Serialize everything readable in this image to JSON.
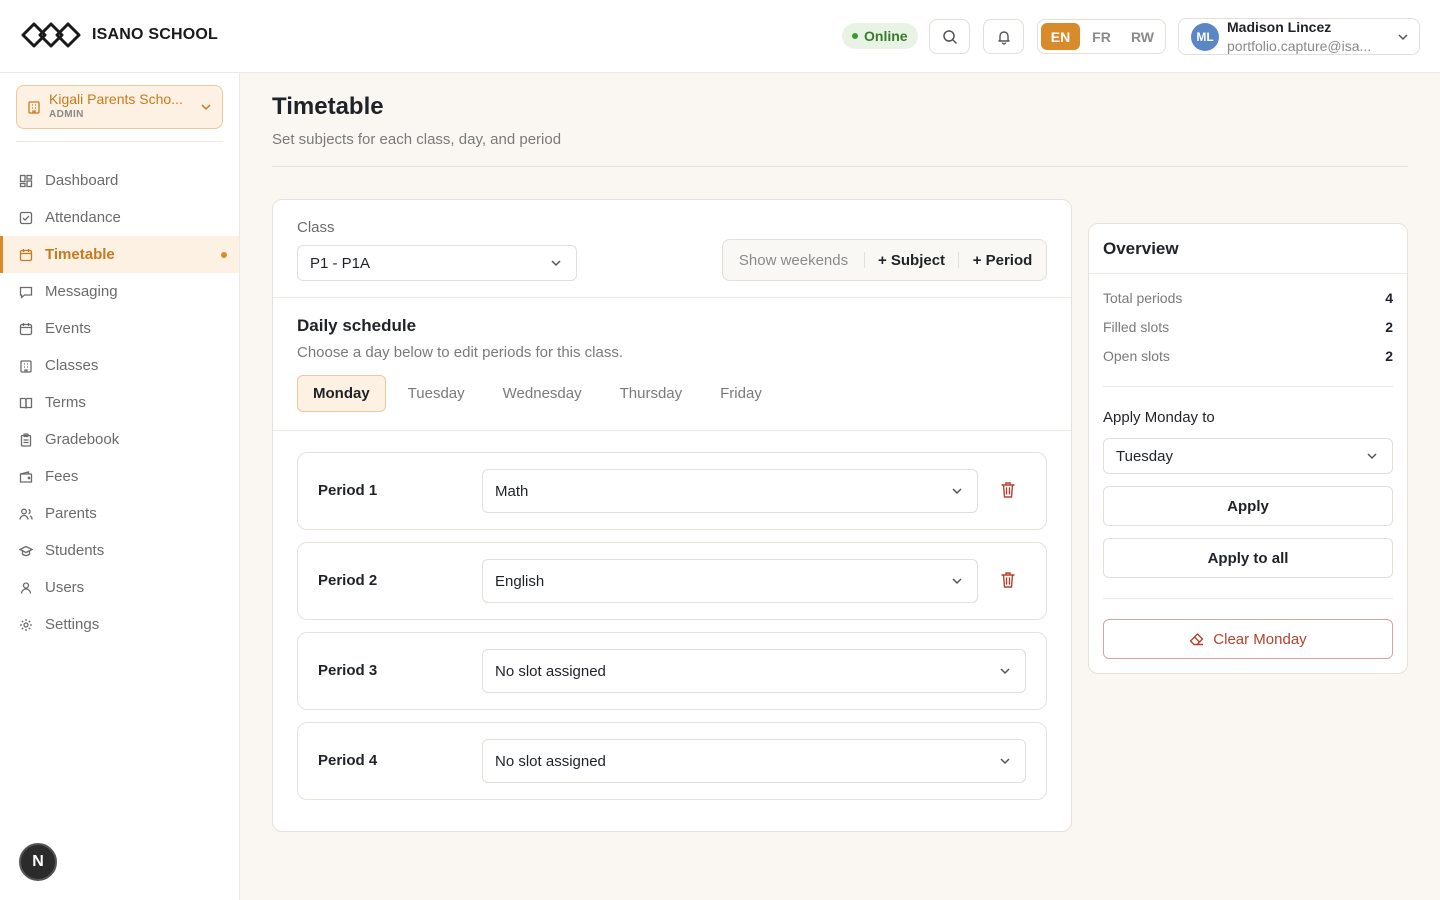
{
  "header": {
    "brand": "ISANO SCHOOL",
    "status": "Online",
    "languages": [
      {
        "code": "EN",
        "active": true
      },
      {
        "code": "FR",
        "active": false
      },
      {
        "code": "RW",
        "active": false
      }
    ],
    "user": {
      "initials": "ML",
      "name": "Madison Lincez",
      "email": "portfolio.capture@isa..."
    }
  },
  "sidebar": {
    "school": {
      "name": "Kigali Parents Scho...",
      "role": "ADMIN"
    },
    "items": [
      {
        "label": "Dashboard",
        "icon": "dashboard-icon"
      },
      {
        "label": "Attendance",
        "icon": "checkbox-icon"
      },
      {
        "label": "Timetable",
        "icon": "calendar-icon",
        "active": true
      },
      {
        "label": "Messaging",
        "icon": "message-icon"
      },
      {
        "label": "Events",
        "icon": "calendar-icon"
      },
      {
        "label": "Classes",
        "icon": "building-icon"
      },
      {
        "label": "Terms",
        "icon": "book-icon"
      },
      {
        "label": "Gradebook",
        "icon": "clipboard-icon"
      },
      {
        "label": "Fees",
        "icon": "wallet-icon"
      },
      {
        "label": "Parents",
        "icon": "users-icon"
      },
      {
        "label": "Students",
        "icon": "graduation-cap-icon"
      },
      {
        "label": "Users",
        "icon": "user-icon"
      },
      {
        "label": "Settings",
        "icon": "gear-icon"
      }
    ],
    "fab_label": "N"
  },
  "page": {
    "title": "Timetable",
    "subtitle": "Set subjects for each class, day, and period"
  },
  "editor": {
    "class_label": "Class",
    "class_value": "P1 - P1A",
    "actions": {
      "show_weekends": "Show weekends",
      "add_subject": "+ Subject",
      "add_period": "+ Period"
    },
    "schedule_title": "Daily schedule",
    "schedule_subtitle": "Choose a day below to edit periods for this class.",
    "days": [
      {
        "label": "Monday",
        "active": true
      },
      {
        "label": "Tuesday",
        "active": false
      },
      {
        "label": "Wednesday",
        "active": false
      },
      {
        "label": "Thursday",
        "active": false
      },
      {
        "label": "Friday",
        "active": false
      }
    ],
    "periods": [
      {
        "label": "Period 1",
        "value": "Math",
        "deletable": true
      },
      {
        "label": "Period 2",
        "value": "English",
        "deletable": true
      },
      {
        "label": "Period 3",
        "value": "No slot assigned",
        "deletable": false
      },
      {
        "label": "Period 4",
        "value": "No slot assigned",
        "deletable": false
      }
    ]
  },
  "overview": {
    "title": "Overview",
    "stats": [
      {
        "label": "Total periods",
        "value": "4"
      },
      {
        "label": "Filled slots",
        "value": "2"
      },
      {
        "label": "Open slots",
        "value": "2"
      }
    ],
    "apply_label": "Apply Monday to",
    "apply_target": "Tuesday",
    "apply_button": "Apply",
    "apply_all_button": "Apply to all",
    "clear_button": "Clear Monday"
  },
  "colors": {
    "accent": "#d98a2b",
    "accent_bg": "#fcf1e2",
    "danger": "#b5412e",
    "success": "#3b7a2e"
  }
}
